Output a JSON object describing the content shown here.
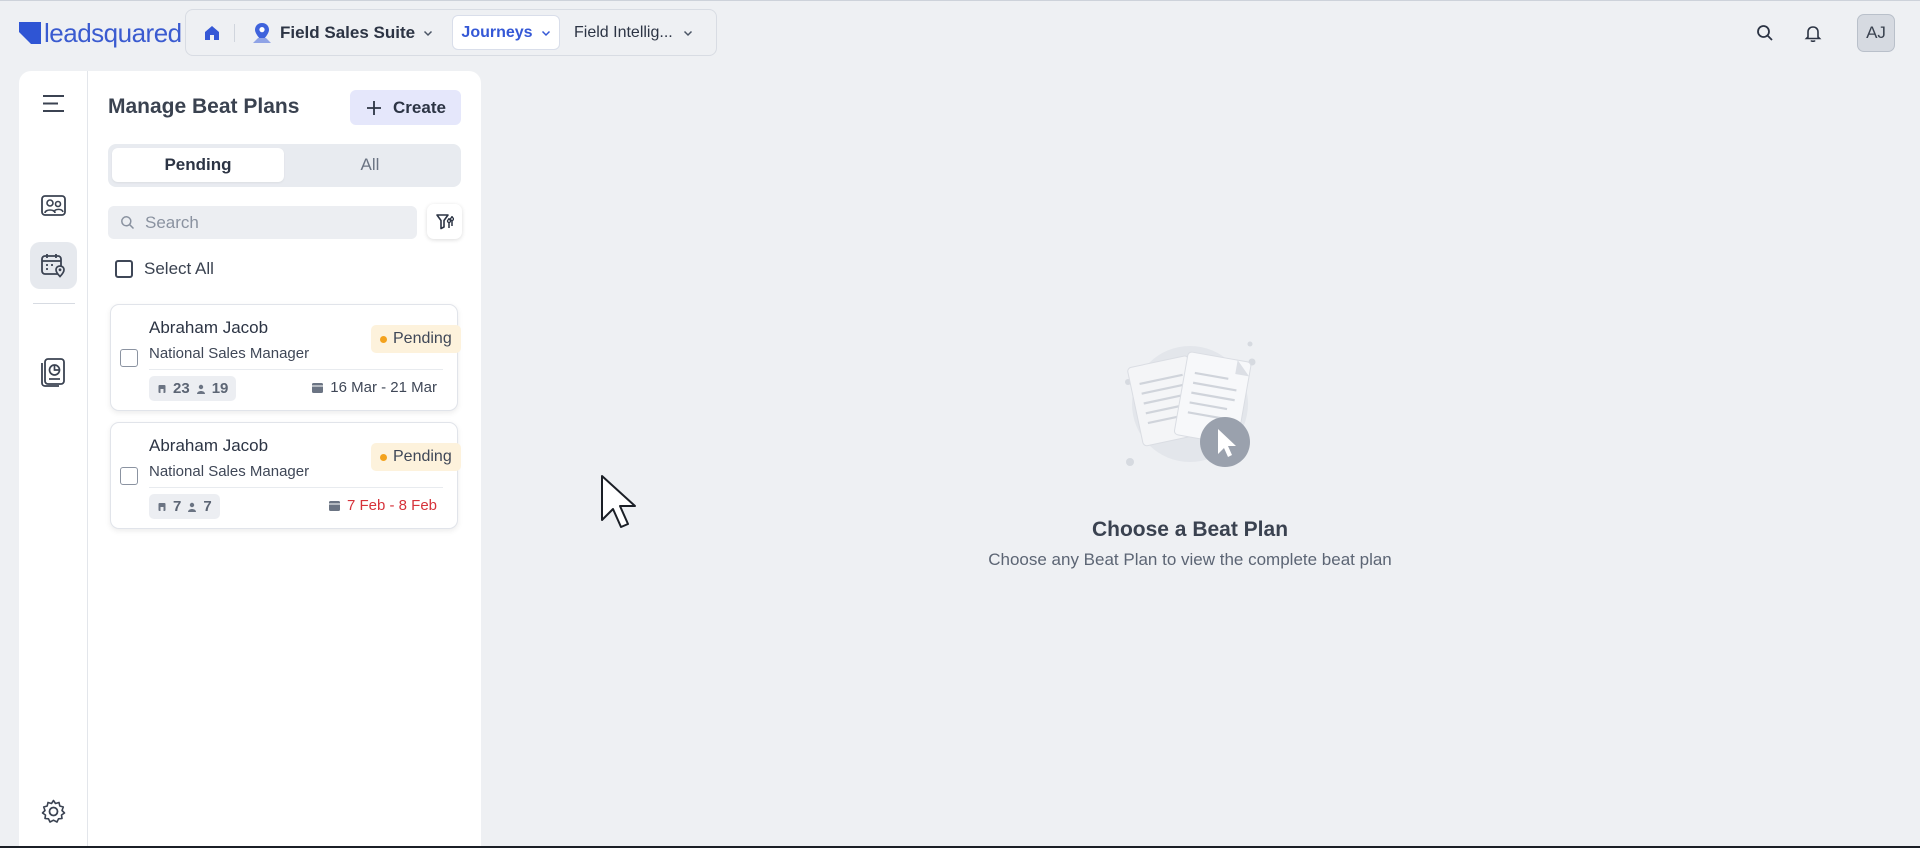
{
  "header": {
    "logo_text": "leadsquared",
    "app_name": "Field Sales Suite",
    "active_tab": "Journeys",
    "second_tab": "Field Intellig...",
    "avatar_initials": "AJ"
  },
  "sidebar": {
    "title": "Manage Beat Plans",
    "create_label": "Create",
    "segments": {
      "pending": "Pending",
      "all": "All"
    },
    "search_placeholder": "Search",
    "select_all_label": "Select All",
    "cards": [
      {
        "name": "Abraham Jacob",
        "role": "National Sales Manager",
        "status": "Pending",
        "count_a": "23",
        "count_b": "19",
        "date_range": "16 Mar - 21 Mar",
        "overdue": false
      },
      {
        "name": "Abraham Jacob",
        "role": "National Sales Manager",
        "status": "Pending",
        "count_a": "7",
        "count_b": "7",
        "date_range": "7 Feb - 8 Feb",
        "overdue": true
      }
    ]
  },
  "main": {
    "empty_title": "Choose a Beat Plan",
    "empty_subtitle": "Choose any Beat Plan to view the complete beat plan"
  },
  "colors": {
    "brand": "#3558d6",
    "pending_dot": "#f3a21d",
    "pending_bg": "#fdf2dc",
    "overdue": "#d6323a",
    "create_bg": "#e5e7fb"
  },
  "icons": {
    "home": "home-icon",
    "app": "map-pin-icon",
    "search": "search-icon",
    "notifications": "bell-icon",
    "menu": "hamburger-icon",
    "rail_1": "customers-icon",
    "rail_2": "calendar-location-icon",
    "rail_3": "report-icon",
    "settings": "gear-icon",
    "filter": "filter-icon"
  }
}
